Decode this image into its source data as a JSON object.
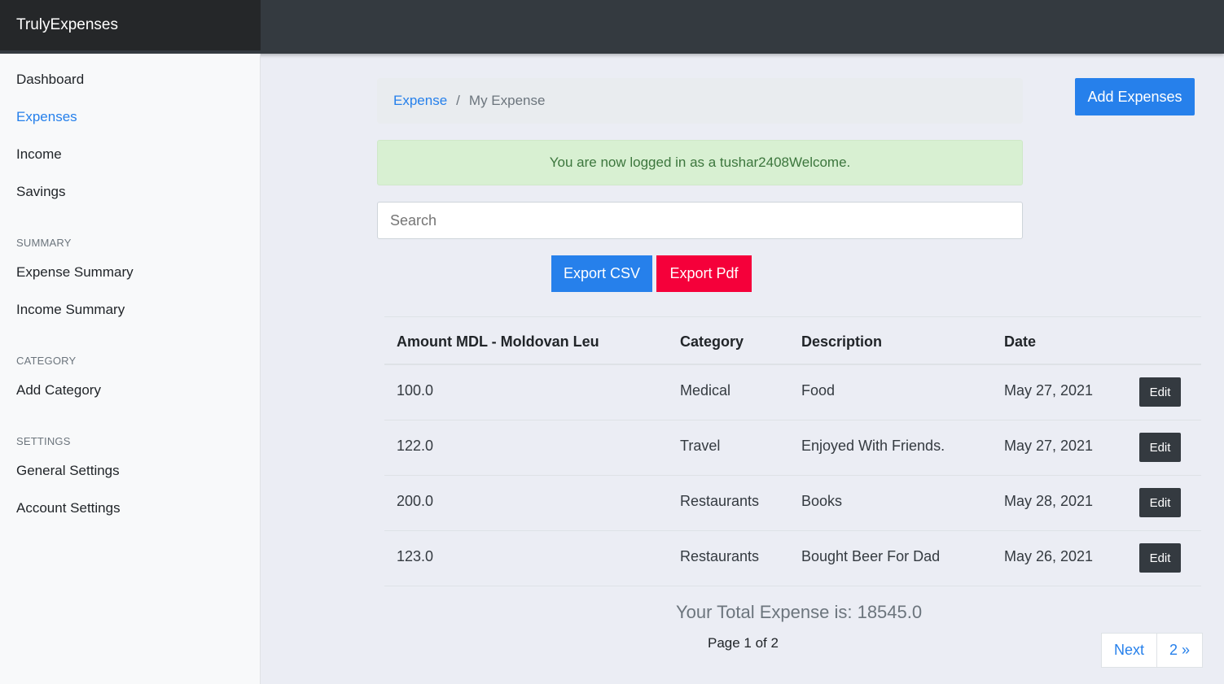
{
  "app": {
    "brand": "TrulyExpenses"
  },
  "sidebar": {
    "items": [
      {
        "label": "Dashboard"
      },
      {
        "label": "Expenses"
      },
      {
        "label": "Income"
      },
      {
        "label": "Savings"
      }
    ],
    "summary_heading": "SUMMARY",
    "summary_items": [
      {
        "label": "Expense Summary"
      },
      {
        "label": "Income Summary"
      }
    ],
    "category_heading": "CATEGORY",
    "category_items": [
      {
        "label": "Add Category"
      }
    ],
    "settings_heading": "SETTINGS",
    "settings_items": [
      {
        "label": "General Settings"
      },
      {
        "label": "Account Settings"
      }
    ]
  },
  "breadcrumb": {
    "link": "Expense",
    "separator": "/",
    "current": "My Expense"
  },
  "actions": {
    "add_label": "Add Expenses",
    "export_csv": "Export CSV",
    "export_pdf": "Export Pdf"
  },
  "alert": {
    "message": "You are now logged in as a tushar2408Welcome."
  },
  "search": {
    "placeholder": "Search",
    "value": ""
  },
  "table": {
    "headers": [
      "Amount MDL - Moldovan Leu",
      "Category",
      "Description",
      "Date"
    ],
    "edit_label": "Edit",
    "rows": [
      {
        "amount": "100.0",
        "category": "Medical",
        "description": "Food",
        "date": "May 27, 2021"
      },
      {
        "amount": "122.0",
        "category": "Travel",
        "description": "Enjoyed With Friends.",
        "date": "May 27, 2021"
      },
      {
        "amount": "200.0",
        "category": "Restaurants",
        "description": "Books",
        "date": "May 28, 2021"
      },
      {
        "amount": "123.0",
        "category": "Restaurants",
        "description": "Bought Beer For Dad",
        "date": "May 26, 2021"
      }
    ]
  },
  "footer": {
    "total_text": "Your Total Expense is: 18545.0",
    "page_info": "Page 1 of 2",
    "next_label": "Next",
    "last_label": "2 »"
  },
  "colors": {
    "primary": "#2680eb",
    "danger": "#f5003a",
    "dark": "#343a40",
    "success_bg": "#d8f0d2"
  }
}
